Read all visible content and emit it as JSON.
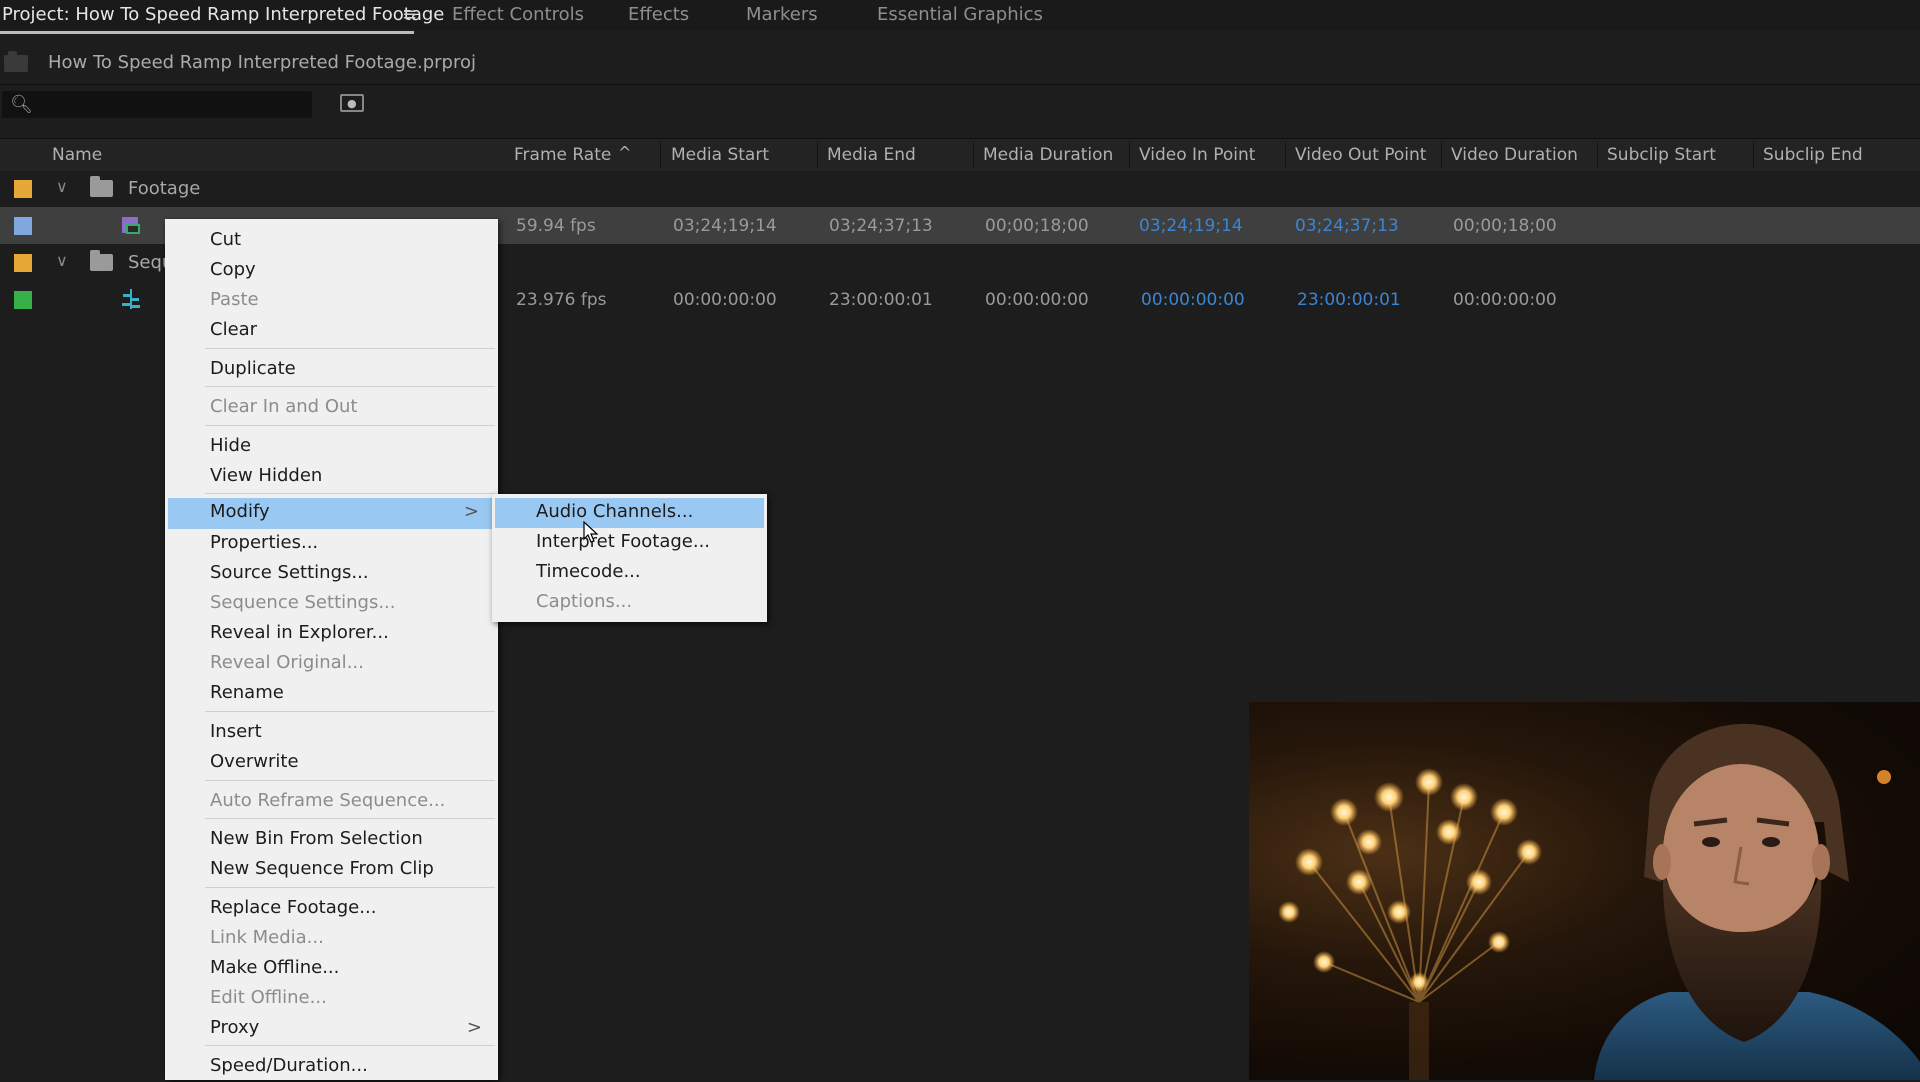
{
  "tabs": [
    {
      "label": "Project: How To Speed Ramp Interpreted Footage",
      "active": true
    },
    {
      "label": "Effect Controls",
      "active": false
    },
    {
      "label": "Effects",
      "active": false
    },
    {
      "label": "Markers",
      "active": false
    },
    {
      "label": "Essential Graphics",
      "active": false
    }
  ],
  "tab_menu_icon": "≡",
  "project_file": "How To Speed Ramp Interpreted Footage.prproj",
  "search": {
    "placeholder": "",
    "icon": "search-icon"
  },
  "columns": [
    "Name",
    "Frame Rate",
    "Media Start",
    "Media End",
    "Media Duration",
    "Video In Point",
    "Video Out Point",
    "Video Duration",
    "Subclip Start",
    "Subclip End"
  ],
  "sort_indicator": "^",
  "rows": [
    {
      "type": "bin",
      "label": "Footage",
      "color": "#e8a838"
    },
    {
      "type": "clip",
      "label": "",
      "color": "#7fa8e0",
      "frame_rate": "59.94 fps",
      "media_start": "03;24;19;14",
      "media_end": "03;24;37;13",
      "media_duration": "00;00;18;00",
      "video_in": "03;24;19;14",
      "video_out": "03;24;37;13",
      "video_duration": "00;00;18;00"
    },
    {
      "type": "bin",
      "label": "Sequ",
      "color": "#e8a838"
    },
    {
      "type": "sequence",
      "label": "",
      "color": "#38b04a",
      "frame_rate": "23.976 fps",
      "media_start": "00:00:00:00",
      "media_end": "23:00:00:01",
      "media_duration": "00:00:00:00",
      "video_in": "00:00:00:00",
      "video_out": "23:00:00:01",
      "video_duration": "00:00:00:00"
    }
  ],
  "context_menu": {
    "items": [
      {
        "label": "Cut",
        "disabled": false
      },
      {
        "label": "Copy",
        "disabled": false
      },
      {
        "label": "Paste",
        "disabled": true
      },
      {
        "label": "Clear",
        "disabled": false
      },
      {
        "label": "Duplicate",
        "disabled": false
      },
      {
        "label": "Clear In and Out",
        "disabled": true
      },
      {
        "label": "Hide",
        "disabled": false
      },
      {
        "label": "View Hidden",
        "disabled": false
      },
      {
        "label": "Modify",
        "disabled": false,
        "highlighted": true,
        "submenu": true
      },
      {
        "label": "Properties...",
        "disabled": false
      },
      {
        "label": "Source Settings...",
        "disabled": false
      },
      {
        "label": "Sequence Settings...",
        "disabled": true
      },
      {
        "label": "Reveal in Explorer...",
        "disabled": false
      },
      {
        "label": "Reveal Original...",
        "disabled": true
      },
      {
        "label": "Rename",
        "disabled": false
      },
      {
        "label": "Insert",
        "disabled": false
      },
      {
        "label": "Overwrite",
        "disabled": false
      },
      {
        "label": "Auto Reframe Sequence...",
        "disabled": true
      },
      {
        "label": "New Bin From Selection",
        "disabled": false
      },
      {
        "label": "New Sequence From Clip",
        "disabled": false
      },
      {
        "label": "Replace Footage...",
        "disabled": false
      },
      {
        "label": "Link Media...",
        "disabled": true
      },
      {
        "label": "Make Offline...",
        "disabled": false
      },
      {
        "label": "Edit Offline...",
        "disabled": true
      },
      {
        "label": "Proxy",
        "disabled": false,
        "submenu": true
      },
      {
        "label": "Speed/Duration...",
        "disabled": false
      }
    ]
  },
  "submenu": {
    "items": [
      {
        "label": "Audio Channels...",
        "disabled": false,
        "highlighted": true
      },
      {
        "label": "Interpret Footage...",
        "disabled": false
      },
      {
        "label": "Timecode...",
        "disabled": false
      },
      {
        "label": "Captions...",
        "disabled": true
      }
    ]
  },
  "submenu_arrow": ">",
  "colors": {
    "selection_blue": "#99c9f2",
    "link_blue": "#3a86d4",
    "menu_bg": "#f0f0f0",
    "panel_bg": "#1d1d1d"
  }
}
